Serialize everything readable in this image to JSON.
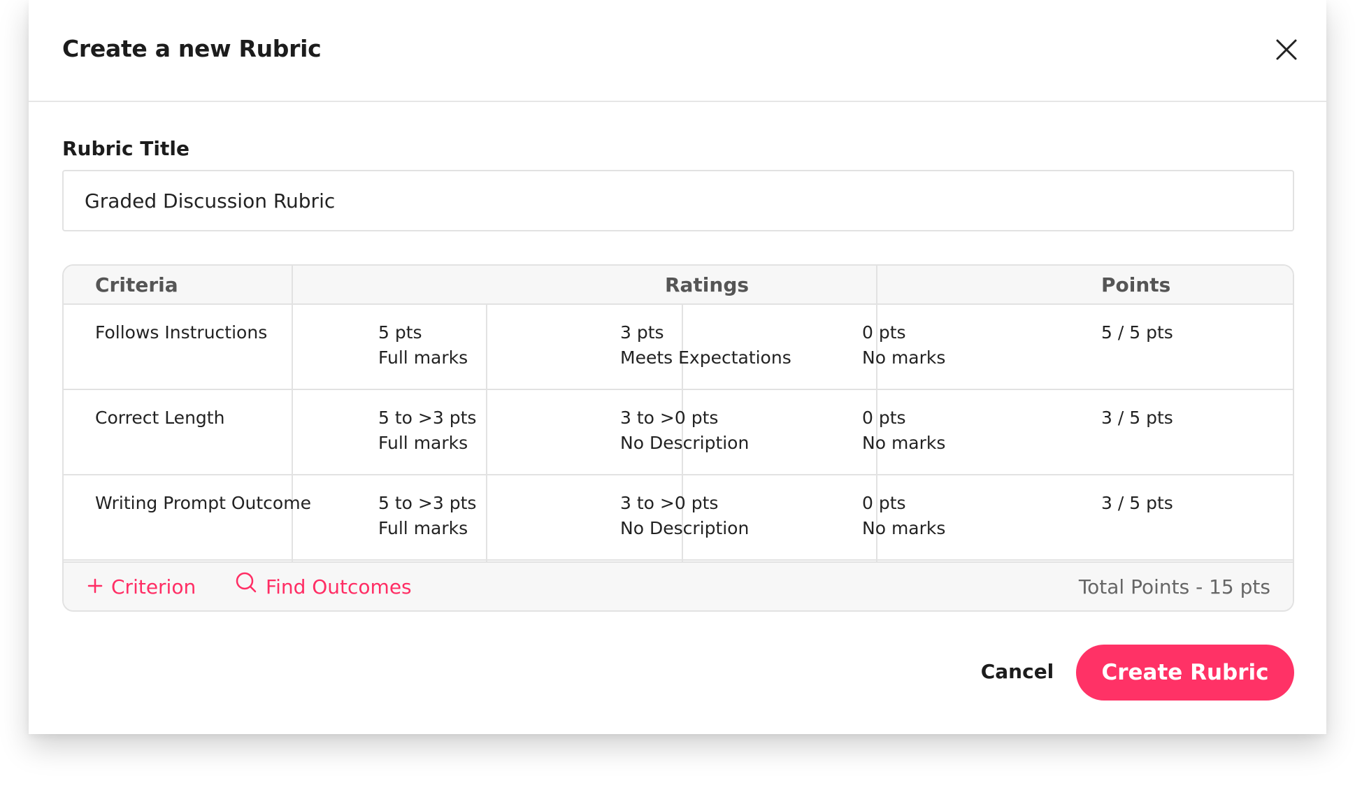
{
  "modal": {
    "title": "Create a new Rubric",
    "close_icon": "close-icon"
  },
  "form": {
    "title_label": "Rubric Title",
    "title_value": "Graded Discussion Rubric"
  },
  "table": {
    "headers": {
      "criteria": "Criteria",
      "ratings": "Ratings",
      "points": "Points"
    },
    "rows": [
      {
        "criterion": "Follows Instructions",
        "ratings": [
          {
            "pts": "5 pts",
            "desc": "Full marks"
          },
          {
            "pts": "3 pts",
            "desc": "Meets Expectations"
          },
          {
            "pts": "0 pts",
            "desc": "No marks"
          }
        ],
        "points": "5 / 5 pts"
      },
      {
        "criterion": "Correct Length",
        "ratings": [
          {
            "pts": "5 to >3 pts",
            "desc": "Full marks"
          },
          {
            "pts": "3 to >0 pts",
            "desc": "No Description"
          },
          {
            "pts": "0 pts",
            "desc": "No marks"
          }
        ],
        "points": "3 / 5 pts"
      },
      {
        "criterion": "Writing Prompt Outcome",
        "ratings": [
          {
            "pts": "5 to >3 pts",
            "desc": "Full marks"
          },
          {
            "pts": "3 to >0 pts",
            "desc": "No Description"
          },
          {
            "pts": "0 pts",
            "desc": "No marks"
          }
        ],
        "points": "3 / 5 pts"
      }
    ],
    "footer": {
      "add_criterion_label": "Criterion",
      "find_outcomes_label": "Find Outcomes",
      "total_points": "Total Points - 15 pts"
    }
  },
  "actions": {
    "cancel_label": "Cancel",
    "create_label": "Create Rubric"
  },
  "colors": {
    "accent": "#ff3266",
    "border": "#e2e2e2",
    "header_bg": "#f7f7f7"
  }
}
